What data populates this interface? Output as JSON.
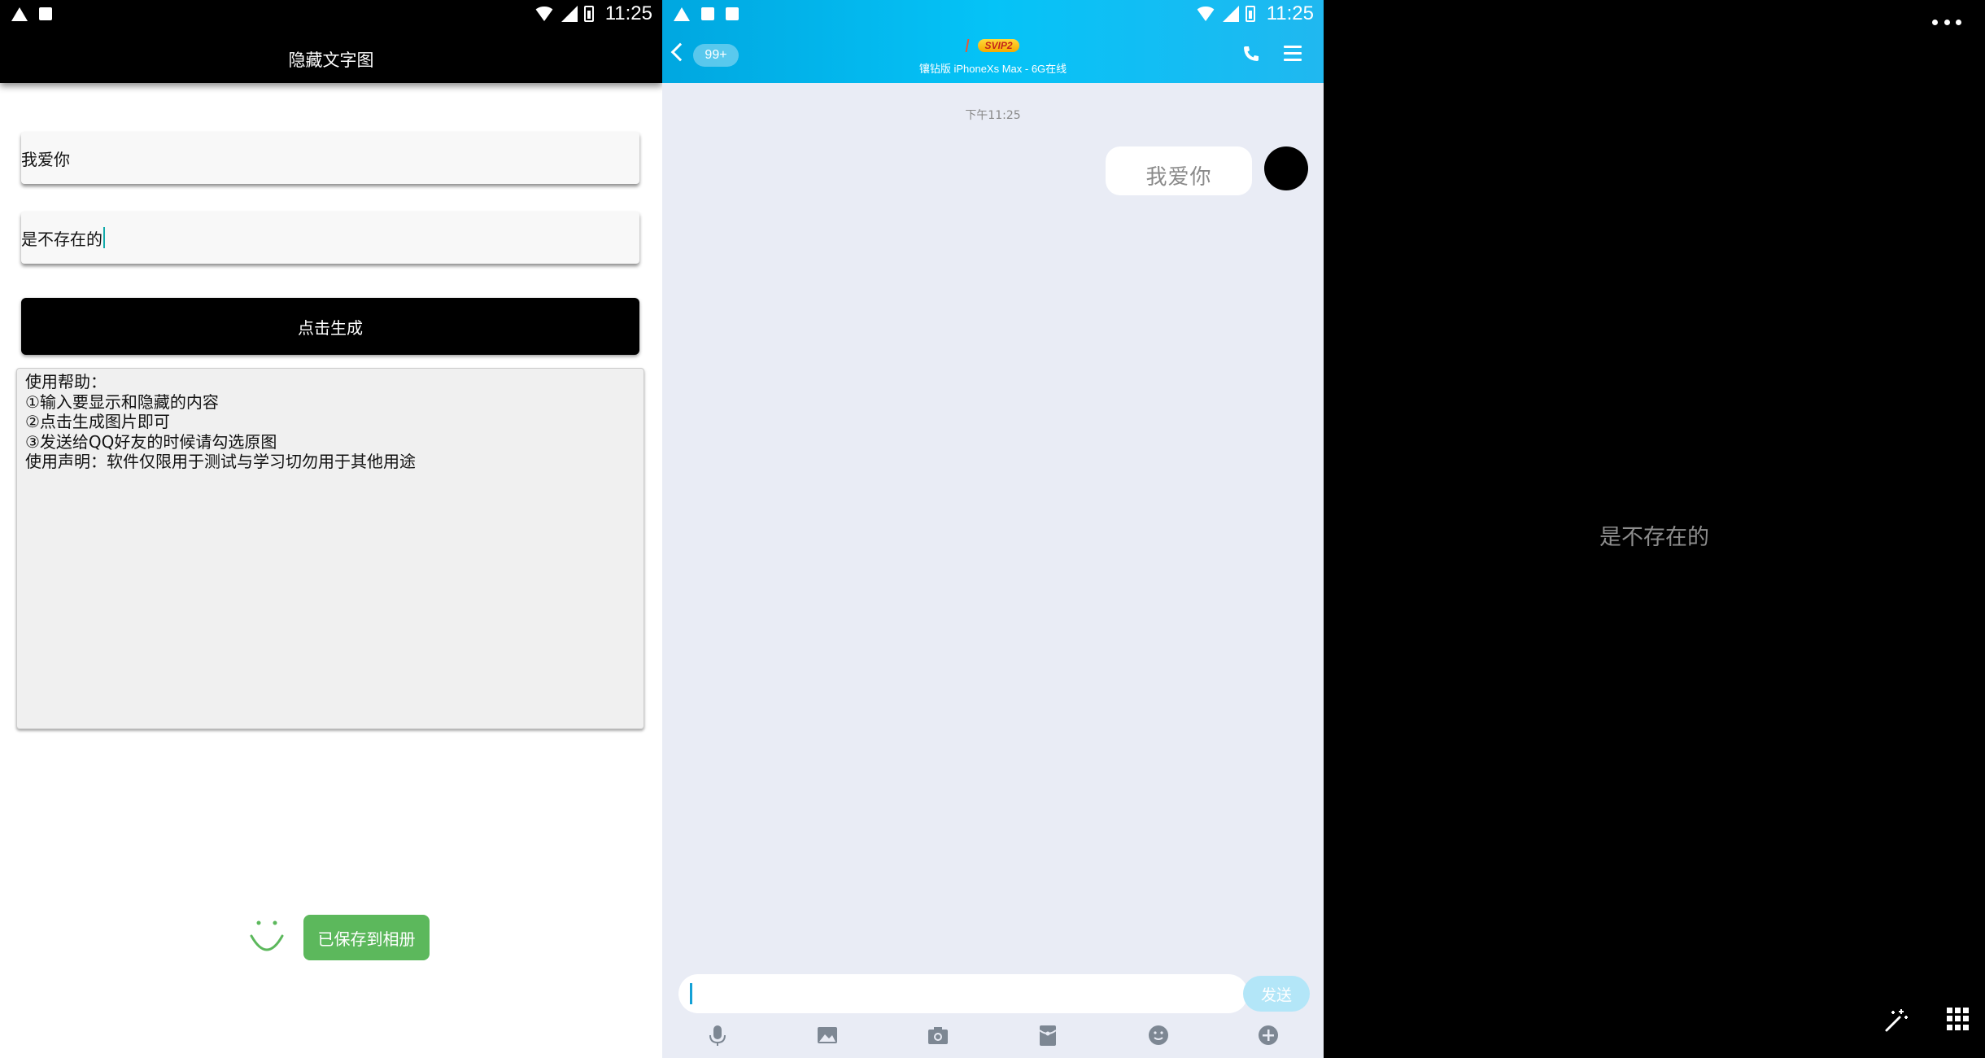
{
  "status_bar": {
    "time": "11:25"
  },
  "panel1": {
    "title": "隐藏文字图",
    "visible_text_value": "我爱你",
    "hidden_text_value": "是不存在的",
    "generate_button": "点击生成",
    "help_lines": [
      "使用帮助：",
      "①输入要显示和隐藏的内容",
      "②点击生成图片即可",
      "③发送给QQ好友的时候请勾选原图",
      "使用声明：软件仅限用于测试与学习切勿用于其他用途"
    ],
    "toast": "已保存到相册",
    "toast_color": "#5cb85c"
  },
  "panel2": {
    "unread_badge": "99+",
    "vip_badge": "SVIP2",
    "subtitle": "镶钻版 iPhoneXs Max - 6G在线",
    "message_time": "下午11:25",
    "image_message_text": "我爱你",
    "send_button": "发送",
    "header_color": "#05c3f7",
    "toolbar_icons": [
      "microphone-icon",
      "image-icon",
      "camera-icon",
      "red-packet-icon",
      "emoji-icon",
      "plus-icon"
    ]
  },
  "panel3": {
    "revealed_text": "是不存在的"
  }
}
